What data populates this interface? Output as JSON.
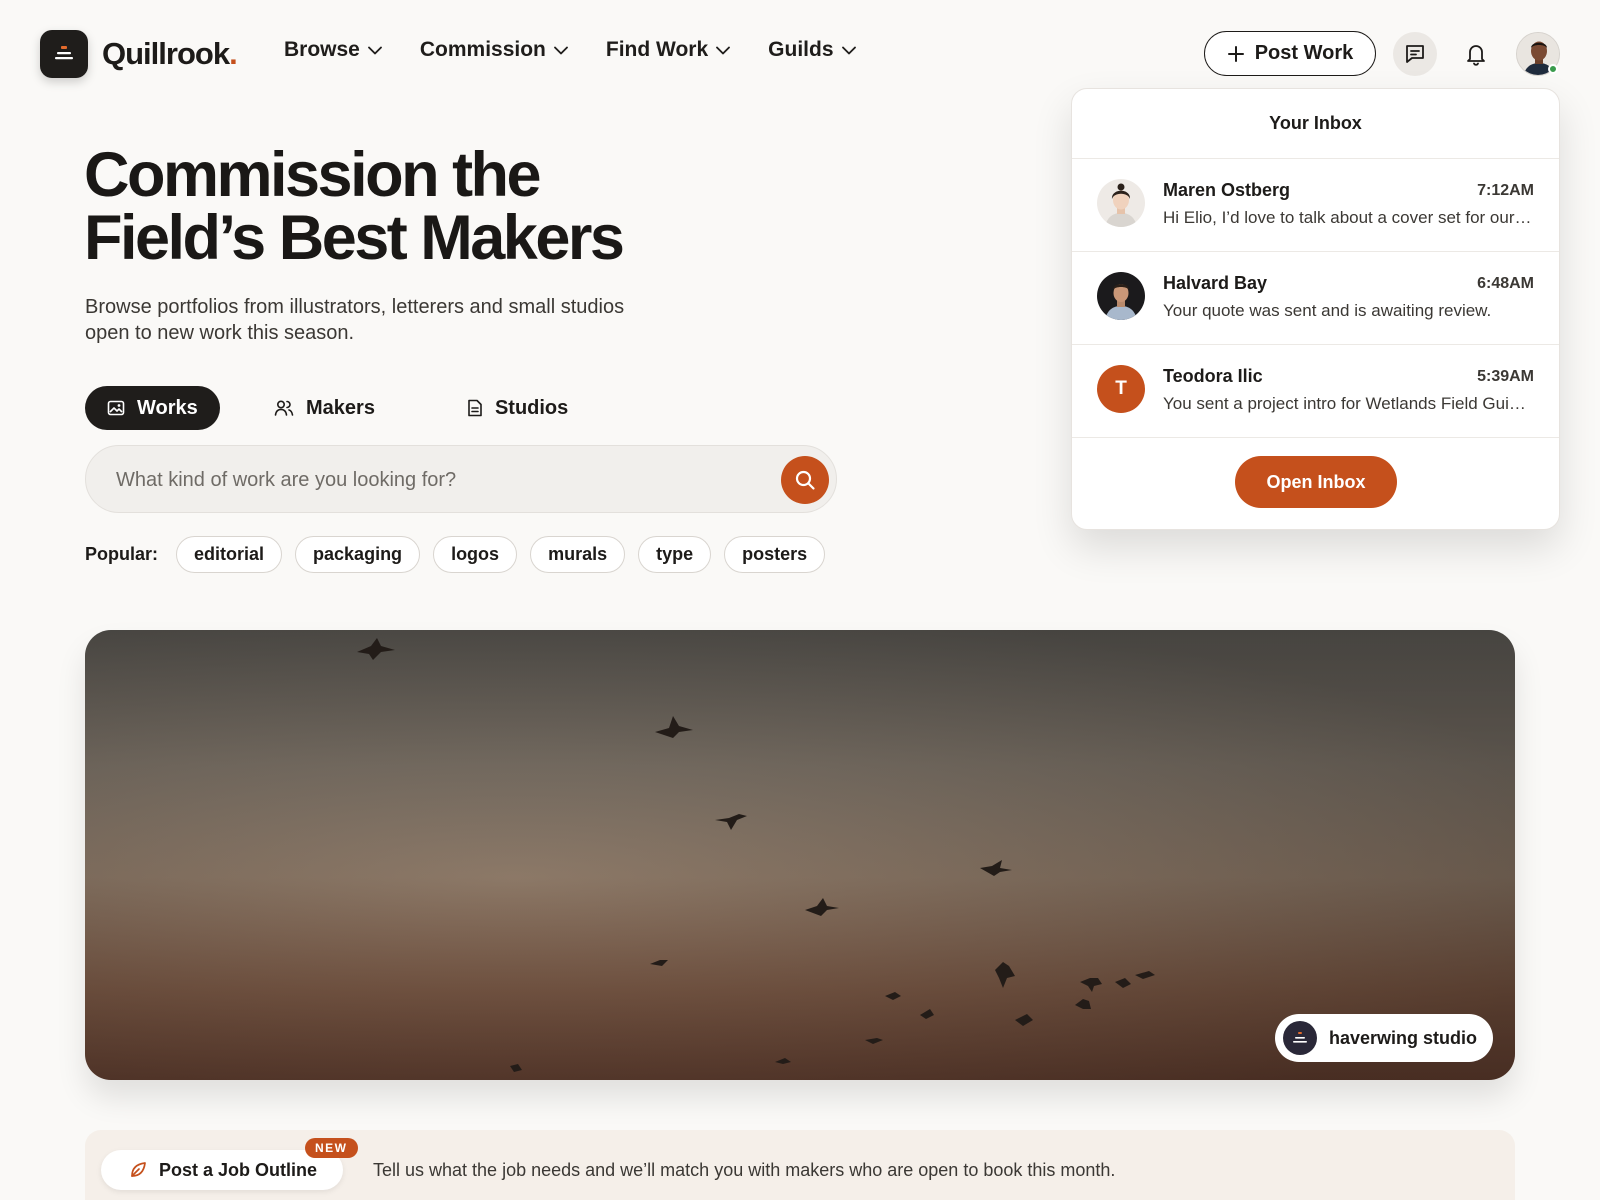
{
  "brand": {
    "name": "Quillrook",
    "dot": ".",
    "accent": "#c5501c"
  },
  "nav": [
    {
      "label": "Browse"
    },
    {
      "label": "Commission"
    },
    {
      "label": "Find Work"
    },
    {
      "label": "Guilds"
    }
  ],
  "header": {
    "post_work_label": "Post Work"
  },
  "hero": {
    "title_line1": "Commission the",
    "title_line2": "Field’s Best Makers",
    "subtitle": "Browse portfolios from illustrators, letterers and small studios open to new work this season."
  },
  "tabs": [
    {
      "label": "Works",
      "icon": "image-icon",
      "active": true
    },
    {
      "label": "Makers",
      "icon": "people-icon",
      "active": false
    },
    {
      "label": "Studios",
      "icon": "document-icon",
      "active": false
    }
  ],
  "search": {
    "placeholder": "What kind of work are you looking for?",
    "value": ""
  },
  "popular": {
    "label": "Popular:",
    "chips": [
      "editorial",
      "packaging",
      "logos",
      "murals",
      "type",
      "posters"
    ]
  },
  "banner": {
    "studio_name": "haverwing studio"
  },
  "promo": {
    "button_label": "Post a Job Outline",
    "badge": "NEW",
    "text": "Tell us what the job needs and we’ll match you with makers who are open to book this month."
  },
  "inbox": {
    "title": "Your Inbox",
    "messages": [
      {
        "name": "Maren Ostberg",
        "time": "7:12AM",
        "preview": "Hi Elio, I’d love to talk about a cover set for our spring list"
      },
      {
        "name": "Halvard Bay",
        "time": "6:48AM",
        "preview": "Your quote was sent and is awaiting review."
      },
      {
        "name": "Teodora Ilic",
        "time": "5:39AM",
        "preview": "You sent a project intro for Wetlands Field Guide illustrations",
        "initial": "T"
      }
    ],
    "open_label": "Open Inbox"
  }
}
